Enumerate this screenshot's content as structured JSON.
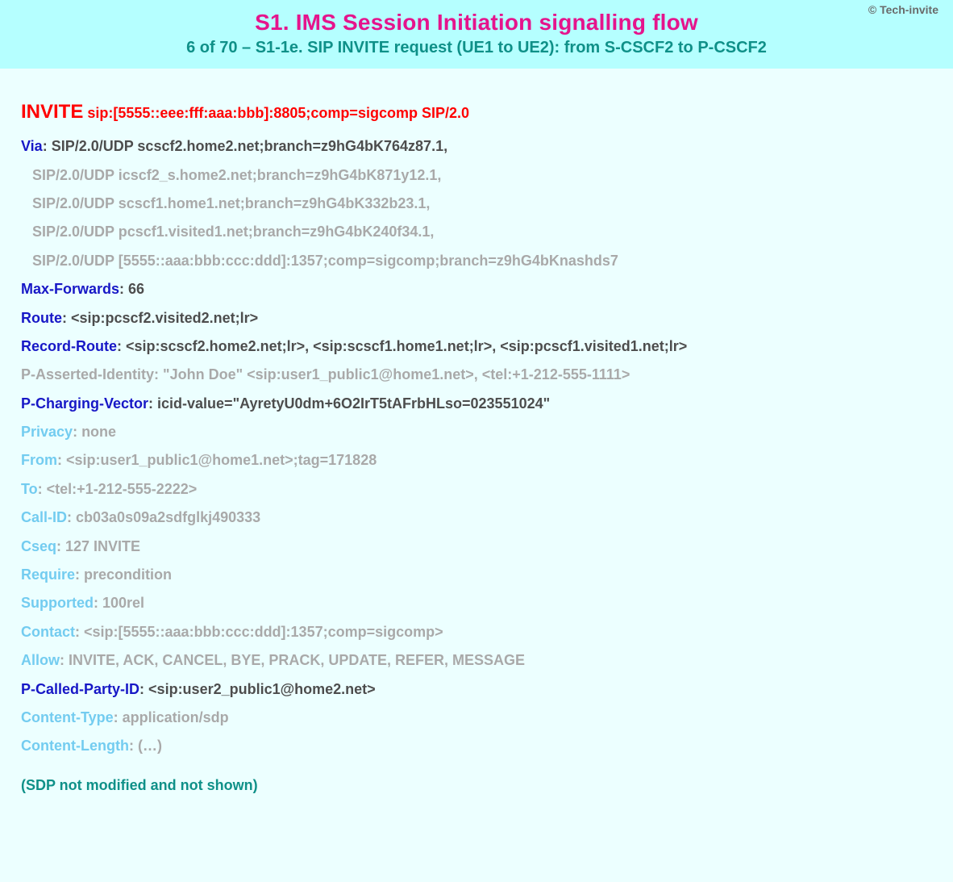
{
  "copyright": "© Tech-invite",
  "title": "S1. IMS Session Initiation signalling flow",
  "subtitle": "6 of 70 – S1-1e. SIP INVITE request (UE1 to UE2): from S-CSCF2 to P-CSCF2",
  "request": {
    "method": "INVITE",
    "uri": "sip:[5555::eee:fff:aaa:bbb]:8805;comp=sigcomp SIP/2.0"
  },
  "via": {
    "label": "Via",
    "first": "SIP/2.0/UDP scscf2.home2.net;branch=z9hG4bK764z87.1,",
    "rest": [
      "SIP/2.0/UDP icscf2_s.home2.net;branch=z9hG4bK871y12.1,",
      "SIP/2.0/UDP scscf1.home1.net;branch=z9hG4bK332b23.1,",
      "SIP/2.0/UDP pcscf1.visited1.net;branch=z9hG4bK240f34.1,",
      "SIP/2.0/UDP [5555::aaa:bbb:ccc:ddd]:1357;comp=sigcomp;branch=z9hG4bKnashds7"
    ]
  },
  "maxforwards": {
    "label": "Max-Forwards",
    "value": "66"
  },
  "route": {
    "label": "Route",
    "value": "<sip:pcscf2.visited2.net;lr>"
  },
  "recordroute": {
    "label": "Record-Route",
    "value": "<sip:scscf2.home2.net;lr>, <sip:scscf1.home1.net;lr>, <sip:pcscf1.visited1.net;lr>"
  },
  "pai": {
    "label": "P-Asserted-Identity",
    "value": "\"John Doe\" <sip:user1_public1@home1.net>, <tel:+1-212-555-1111>"
  },
  "pcharging": {
    "label": "P-Charging-Vector",
    "value": "icid-value=\"AyretyU0dm+6O2IrT5tAFrbHLso=023551024\""
  },
  "privacy": {
    "label": "Privacy",
    "value": "none"
  },
  "from": {
    "label": "From",
    "value": "<sip:user1_public1@home1.net>;tag=171828"
  },
  "to": {
    "label": "To",
    "value": "<tel:+1-212-555-2222>"
  },
  "callid": {
    "label": "Call-ID",
    "value": "cb03a0s09a2sdfglkj490333"
  },
  "cseq": {
    "label": "Cseq",
    "value": "127 INVITE"
  },
  "require": {
    "label": "Require",
    "value": "precondition"
  },
  "supported": {
    "label": "Supported",
    "value": "100rel"
  },
  "contact": {
    "label": "Contact",
    "value": "<sip:[5555::aaa:bbb:ccc:ddd]:1357;comp=sigcomp>"
  },
  "allow": {
    "label": "Allow",
    "value": "INVITE, ACK, CANCEL, BYE, PRACK, UPDATE, REFER, MESSAGE"
  },
  "pcalled": {
    "label": "P-Called-Party-ID",
    "value": "<sip:user2_public1@home2.net>"
  },
  "ctype": {
    "label": "Content-Type",
    "value": "application/sdp"
  },
  "clen": {
    "label": "Content-Length",
    "value": "(…)"
  },
  "footer": "(SDP not modified and not shown)"
}
